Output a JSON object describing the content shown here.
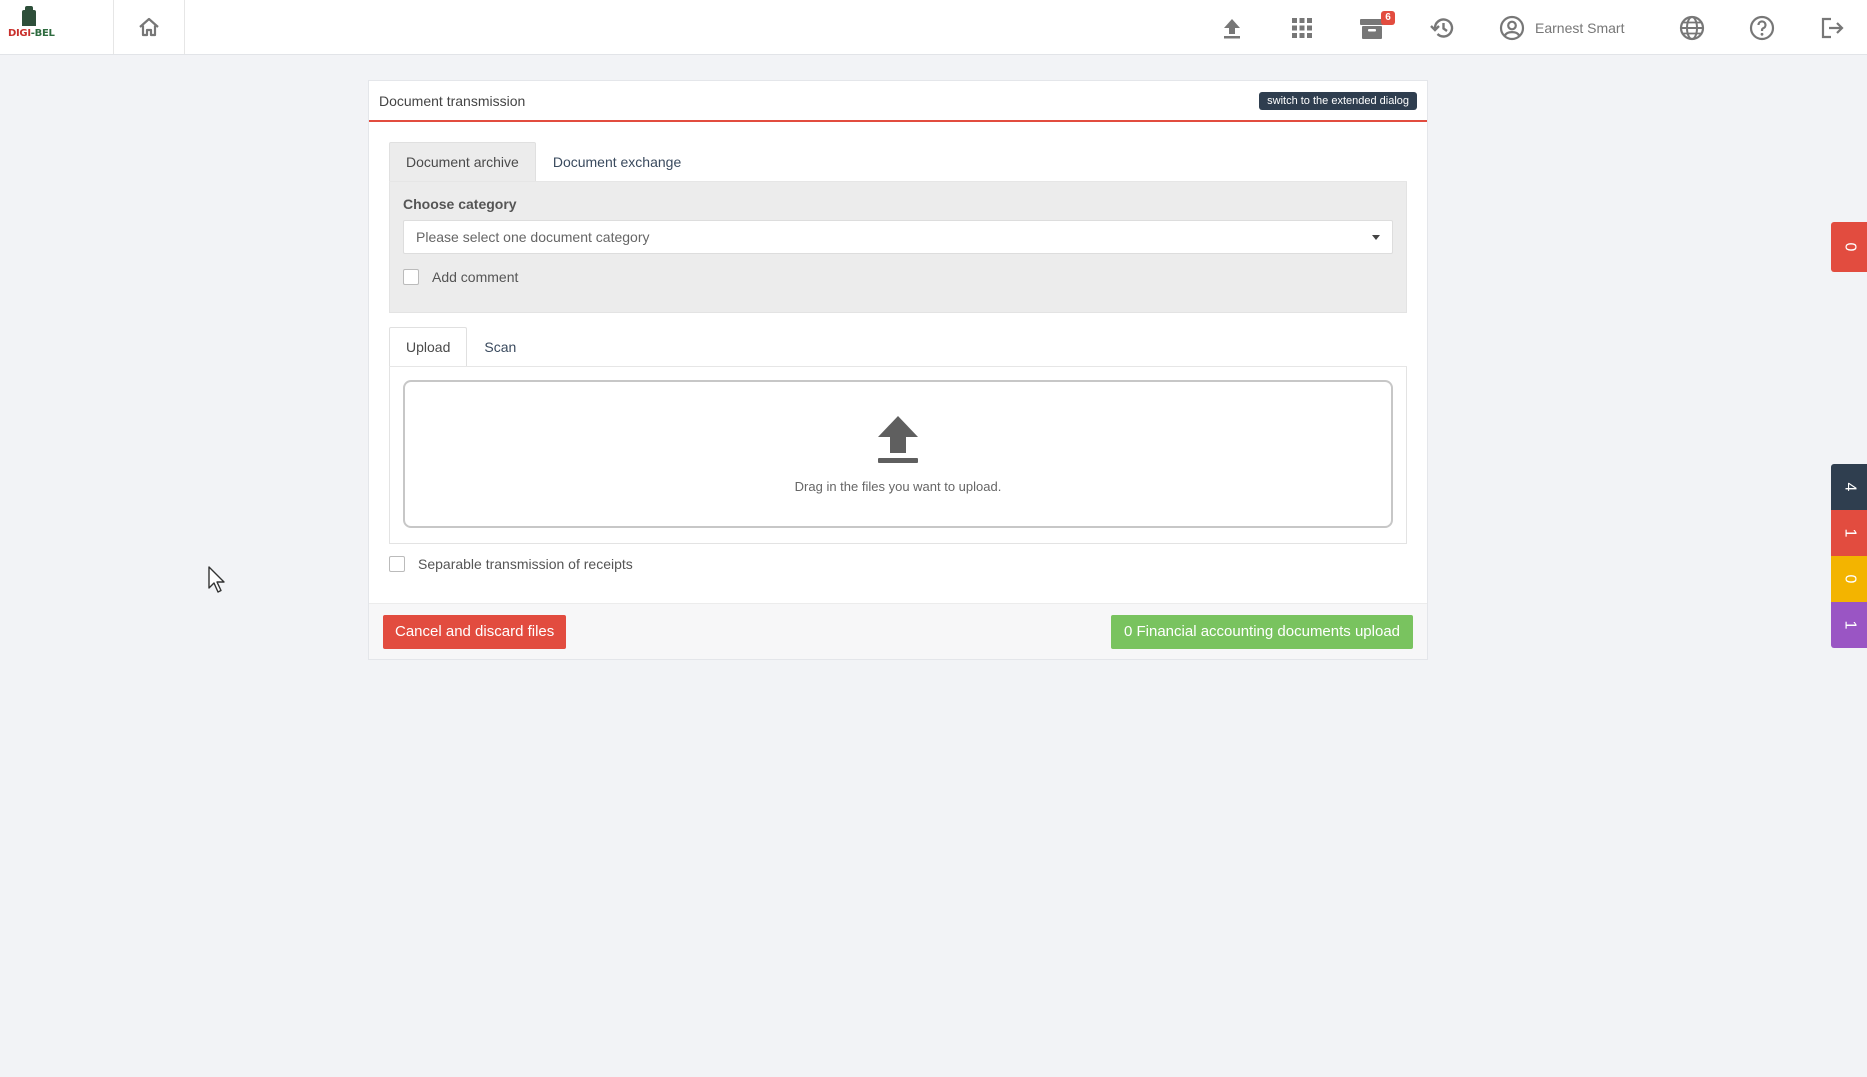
{
  "header": {
    "logo": {
      "word_a": "DIGI",
      "word_sep": "-",
      "word_b": "BEL"
    },
    "user_name": "Earnest Smart",
    "archive_badge": "6",
    "icons": [
      "home-icon",
      "upload-icon",
      "apps-grid-icon",
      "archive-icon",
      "history-icon",
      "user-icon",
      "globe-icon",
      "help-icon",
      "logout-icon"
    ]
  },
  "panel": {
    "title": "Document transmission",
    "extended_button": "switch to the extended dialog",
    "tabs": [
      {
        "label": "Document archive",
        "active": true
      },
      {
        "label": "Document exchange",
        "active": false
      }
    ],
    "category": {
      "label": "Choose category",
      "placeholder": "Please select one document category",
      "add_comment": "Add comment"
    },
    "upload_tabs": [
      {
        "label": "Upload",
        "active": true
      },
      {
        "label": "Scan",
        "active": false
      }
    ],
    "dropzone_text": "Drag in the files you want to upload.",
    "separable_label": "Separable transmission of receipts",
    "cancel_button": "Cancel and discard files",
    "upload_button": "0 Financial accounting documents upload"
  },
  "side_widgets": {
    "top_glyph": "0",
    "stack": [
      "4",
      "1",
      "0",
      "1"
    ]
  },
  "colors": {
    "accent_red": "#e24c3f",
    "success_green": "#79c35f",
    "dark_navy": "#2f3e4f",
    "amber": "#f3b400",
    "purple": "#9a55c4"
  }
}
